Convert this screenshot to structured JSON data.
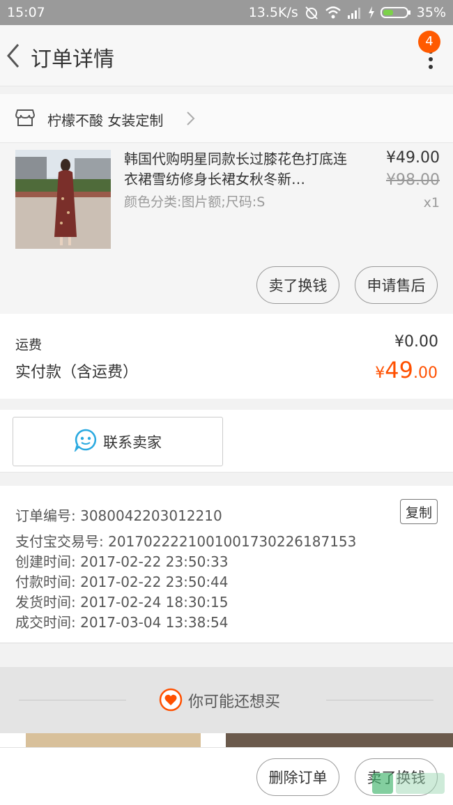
{
  "status_bar": {
    "time": "15:07",
    "speed": "13.5K/s",
    "battery": "35%"
  },
  "nav": {
    "title": "订单详情",
    "badge_count": "4"
  },
  "shop": {
    "name": "柠檬不酸 女装定制"
  },
  "product": {
    "title": "韩国代购明星同款长过膝花色打底连衣裙雪纺修身长裙女秋冬新…",
    "sku": "颜色分类:图片额;尺码:S",
    "price": "¥49.00",
    "original_price": "¥98.00",
    "quantity": "x1",
    "buttons": {
      "sell": "卖了换钱",
      "after_sale": "申请售后"
    }
  },
  "fees": {
    "shipping_label": "运费",
    "shipping_value": "¥0.00",
    "paid_label": "实付款（含运费）",
    "paid_currency": "¥",
    "paid_integer": "49",
    "paid_decimal": ".00"
  },
  "contact": {
    "label": "联系卖家"
  },
  "order_info": {
    "copy_label": "复制",
    "rows": [
      "订单编号: 3080042203012210",
      "支付宝交易号: 2017022221001001730226187153",
      "创建时间: 2017-02-22 23:50:33",
      "付款时间: 2017-02-22 23:50:44",
      "发货时间: 2017-02-24 18:30:15",
      "成交时间: 2017-03-04 13:38:54"
    ]
  },
  "recommend": {
    "label": "你可能还想买"
  },
  "bottom_bar": {
    "delete": "删除订单",
    "sell": "卖了换钱"
  },
  "colors": {
    "accent": "#ff5000",
    "badge": "#ff5a00",
    "contact_icon": "#29a9e0"
  }
}
